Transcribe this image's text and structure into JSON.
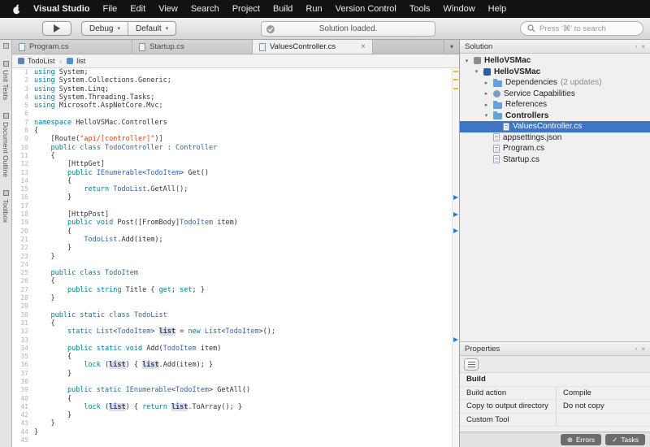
{
  "colors": {
    "kw": "#00829b",
    "type": "#3364a4",
    "str": "#cf4a1d",
    "selection": "#3e75c5",
    "accent": "#3e75c5",
    "mark_yellow": "#eec200",
    "mark_arrow": "#2d7bd4"
  },
  "menubar": {
    "app": "Visual Studio",
    "items": [
      "File",
      "Edit",
      "View",
      "Search",
      "Project",
      "Build",
      "Run",
      "Version Control",
      "Tools",
      "Window",
      "Help"
    ]
  },
  "toolbar": {
    "config": "Debug",
    "device": "Default",
    "status": "Solution loaded.",
    "search_placeholder": "Press '⌘' to search"
  },
  "left_strip": {
    "tabs": [
      "Unit Tests",
      "Document Outline",
      "Toolbox"
    ]
  },
  "editor": {
    "tabs": [
      {
        "label": "Program.cs",
        "active": false
      },
      {
        "label": "Startup.cs",
        "active": false
      },
      {
        "label": "ValuesController.cs",
        "active": true
      }
    ],
    "breadcrumb": [
      {
        "label": "TodoList",
        "icon": "class"
      },
      {
        "label": "list",
        "icon": "field"
      }
    ],
    "change_marks_lines": [
      1,
      2,
      3
    ],
    "arrow_marks_lines": [
      16,
      18,
      20,
      33
    ],
    "lines": [
      [
        [
          "k",
          "using "
        ],
        [
          "p",
          "System;"
        ]
      ],
      [
        [
          "k",
          "using "
        ],
        [
          "p",
          "System.Collections.Generic;"
        ]
      ],
      [
        [
          "k",
          "using "
        ],
        [
          "p",
          "System.Linq;"
        ]
      ],
      [
        [
          "k",
          "using "
        ],
        [
          "p",
          "System.Threading.Tasks;"
        ]
      ],
      [
        [
          "k",
          "using "
        ],
        [
          "p",
          "Microsoft.AspNetCore.Mvc;"
        ]
      ],
      [],
      [
        [
          "k",
          "namespace "
        ],
        [
          "p",
          "HelloVSMac.Controllers"
        ]
      ],
      [
        [
          "p",
          "{"
        ]
      ],
      [
        [
          "p",
          "    [Route("
        ],
        [
          "s",
          "\"api/[controller]\""
        ],
        [
          "p",
          ")]"
        ]
      ],
      [
        [
          "p",
          "    "
        ],
        [
          "k",
          "public class "
        ],
        [
          "t",
          "TodoController"
        ],
        [
          "p",
          " : "
        ],
        [
          "t",
          "Controller"
        ]
      ],
      [
        [
          "p",
          "    {"
        ]
      ],
      [
        [
          "p",
          "        [HttpGet]"
        ]
      ],
      [
        [
          "p",
          "        "
        ],
        [
          "k",
          "public "
        ],
        [
          "t",
          "IEnumerable"
        ],
        [
          "p",
          "<"
        ],
        [
          "t",
          "TodoItem"
        ],
        [
          "p",
          "> Get()"
        ]
      ],
      [
        [
          "p",
          "        {"
        ]
      ],
      [
        [
          "p",
          "            "
        ],
        [
          "k",
          "return "
        ],
        [
          "t",
          "TodoList"
        ],
        [
          "p",
          ".GetAll();"
        ]
      ],
      [
        [
          "p",
          "        }"
        ]
      ],
      [],
      [
        [
          "p",
          "        [HttpPost]"
        ]
      ],
      [
        [
          "p",
          "        "
        ],
        [
          "k",
          "public void "
        ],
        [
          "p",
          "Post([FromBody]"
        ],
        [
          "t",
          "TodoItem"
        ],
        [
          "p",
          " item)"
        ]
      ],
      [
        [
          "p",
          "        {"
        ]
      ],
      [
        [
          "p",
          "            "
        ],
        [
          "t",
          "TodoList"
        ],
        [
          "p",
          ".Add(item);"
        ]
      ],
      [
        [
          "p",
          "        }"
        ]
      ],
      [
        [
          "p",
          "    }"
        ]
      ],
      [],
      [
        [
          "p",
          "    "
        ],
        [
          "k",
          "public class "
        ],
        [
          "t",
          "TodoItem"
        ]
      ],
      [
        [
          "p",
          "    {"
        ]
      ],
      [
        [
          "p",
          "        "
        ],
        [
          "k",
          "public string "
        ],
        [
          "p",
          "Title { "
        ],
        [
          "k",
          "get"
        ],
        [
          "p",
          "; "
        ],
        [
          "k",
          "set"
        ],
        [
          "p",
          "; }"
        ]
      ],
      [
        [
          "p",
          "    }"
        ]
      ],
      [],
      [
        [
          "p",
          "    "
        ],
        [
          "k",
          "public static class "
        ],
        [
          "t",
          "TodoList"
        ]
      ],
      [
        [
          "p",
          "    {"
        ]
      ],
      [
        [
          "p",
          "        "
        ],
        [
          "k",
          "static "
        ],
        [
          "t",
          "List"
        ],
        [
          "p",
          "<"
        ],
        [
          "t",
          "TodoItem"
        ],
        [
          "p",
          "> "
        ],
        [
          "h",
          "list"
        ],
        [
          "p",
          " = "
        ],
        [
          "k",
          "new "
        ],
        [
          "t",
          "List"
        ],
        [
          "p",
          "<"
        ],
        [
          "t",
          "TodoItem"
        ],
        [
          "p",
          ">();"
        ]
      ],
      [],
      [
        [
          "p",
          "        "
        ],
        [
          "k",
          "public static void "
        ],
        [
          "p",
          "Add("
        ],
        [
          "t",
          "TodoItem"
        ],
        [
          "p",
          " item)"
        ]
      ],
      [
        [
          "p",
          "        {"
        ]
      ],
      [
        [
          "p",
          "            "
        ],
        [
          "k",
          "lock "
        ],
        [
          "p",
          "("
        ],
        [
          "h",
          "list"
        ],
        [
          "p",
          ") { "
        ],
        [
          "h",
          "list"
        ],
        [
          "p",
          ".Add(item); }"
        ]
      ],
      [
        [
          "p",
          "        }"
        ]
      ],
      [],
      [
        [
          "p",
          "        "
        ],
        [
          "k",
          "public static "
        ],
        [
          "t",
          "IEnumerable"
        ],
        [
          "p",
          "<"
        ],
        [
          "t",
          "TodoItem"
        ],
        [
          "p",
          "> GetAll()"
        ]
      ],
      [
        [
          "p",
          "        {"
        ]
      ],
      [
        [
          "p",
          "            "
        ],
        [
          "k",
          "lock "
        ],
        [
          "p",
          "("
        ],
        [
          "h",
          "list"
        ],
        [
          "p",
          ") { "
        ],
        [
          "k",
          "return "
        ],
        [
          "h",
          "list"
        ],
        [
          "p",
          ".ToArray(); }"
        ]
      ],
      [
        [
          "p",
          "        }"
        ]
      ],
      [
        [
          "p",
          "    }"
        ]
      ],
      [
        [
          "p",
          "}"
        ]
      ],
      []
    ]
  },
  "solution_pane": {
    "title": "Solution",
    "items": [
      {
        "depth": 0,
        "disclosure": "open",
        "icon": "solution",
        "label": "HelloVSMac",
        "bold": true
      },
      {
        "depth": 1,
        "disclosure": "open",
        "icon": "project",
        "label": "HelloVSMac",
        "bold": true
      },
      {
        "depth": 2,
        "disclosure": "closed",
        "icon": "folder",
        "label": "Dependencies",
        "badge": "(2 updates)"
      },
      {
        "depth": 2,
        "disclosure": "closed",
        "icon": "capability",
        "label": "Service Capabilities"
      },
      {
        "depth": 2,
        "disclosure": "closed",
        "icon": "folder",
        "label": "References"
      },
      {
        "depth": 2,
        "disclosure": "open",
        "icon": "folder",
        "label": "Controllers",
        "bold": true
      },
      {
        "depth": 3,
        "disclosure": "none",
        "icon": "file-cs",
        "label": "ValuesController.cs",
        "selected": true
      },
      {
        "depth": 2,
        "disclosure": "none",
        "icon": "file-json",
        "label": "appsettings.json"
      },
      {
        "depth": 2,
        "disclosure": "none",
        "icon": "file-cs",
        "label": "Program.cs"
      },
      {
        "depth": 2,
        "disclosure": "none",
        "icon": "file-cs",
        "label": "Startup.cs"
      }
    ]
  },
  "properties_pane": {
    "title": "Properties",
    "rows": [
      {
        "label": "Build",
        "value": "",
        "header": true
      },
      {
        "label": "Build action",
        "value": "Compile"
      },
      {
        "label": "Copy to output directory",
        "value": "Do not copy"
      },
      {
        "label": "Custom Tool",
        "value": ""
      }
    ]
  },
  "statusbar": {
    "errors_label": "Errors",
    "tasks_label": "Tasks"
  }
}
